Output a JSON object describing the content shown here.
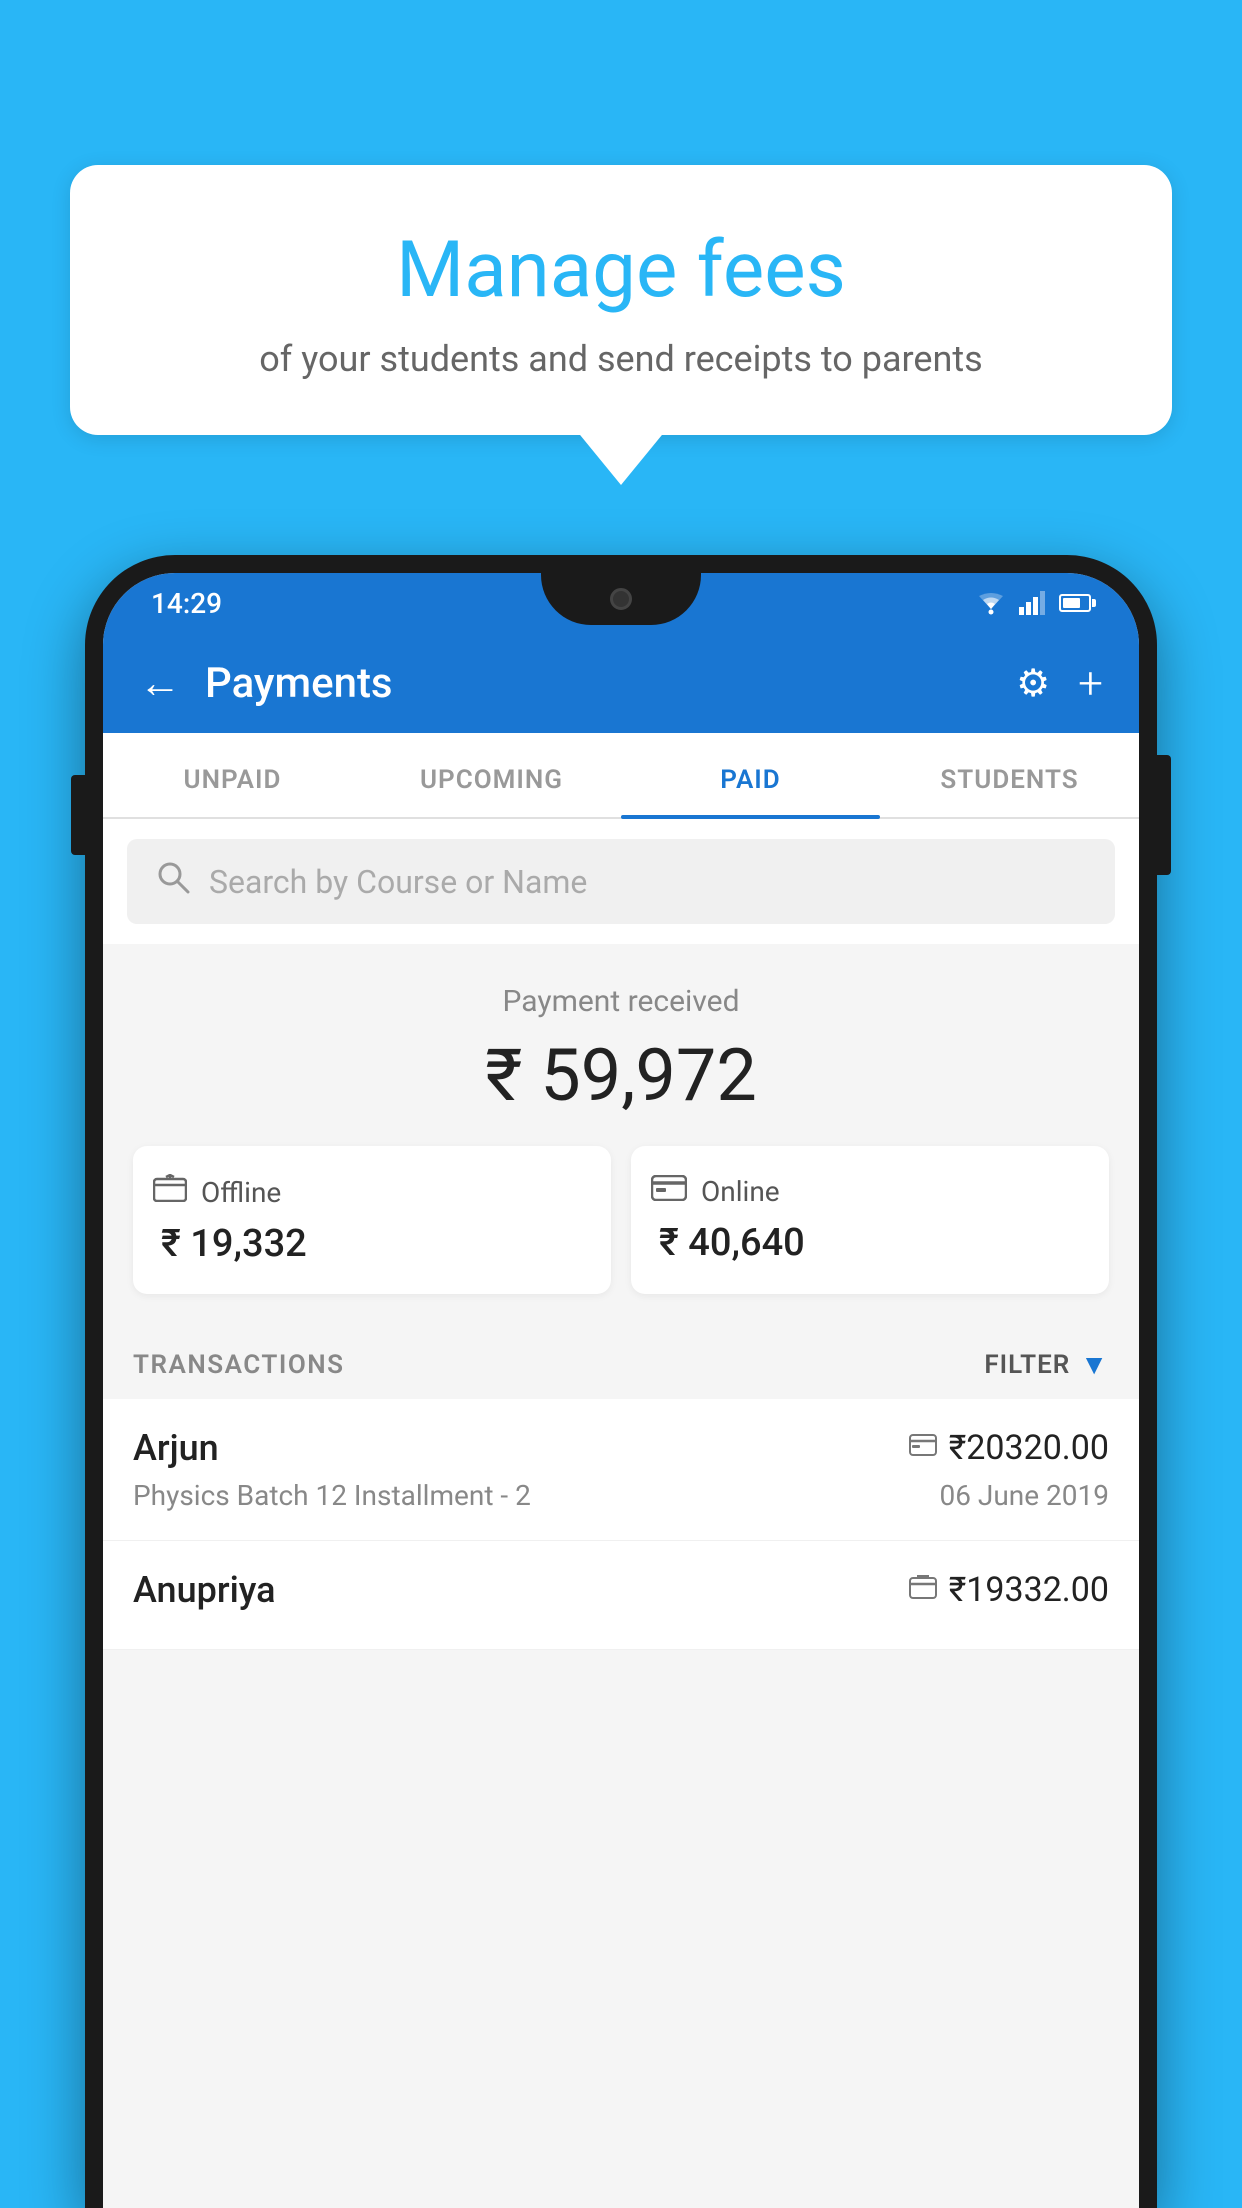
{
  "background_color": "#29b6f6",
  "bubble": {
    "title": "Manage fees",
    "subtitle": "of your students and send receipts to parents"
  },
  "status_bar": {
    "time": "14:29",
    "wifi": "▾",
    "signal": "▲",
    "battery": "▌"
  },
  "app_bar": {
    "title": "Payments",
    "back_icon": "←",
    "settings_icon": "⚙",
    "add_icon": "+"
  },
  "tabs": [
    {
      "label": "UNPAID",
      "active": false
    },
    {
      "label": "UPCOMING",
      "active": false
    },
    {
      "label": "PAID",
      "active": true
    },
    {
      "label": "STUDENTS",
      "active": false
    }
  ],
  "search": {
    "placeholder": "Search by Course or Name"
  },
  "payment_summary": {
    "label": "Payment received",
    "total": "₹ 59,972",
    "offline": {
      "type": "Offline",
      "amount": "₹ 19,332"
    },
    "online": {
      "type": "Online",
      "amount": "₹ 40,640"
    }
  },
  "transactions": {
    "section_label": "TRANSACTIONS",
    "filter_label": "FILTER",
    "items": [
      {
        "name": "Arjun",
        "amount": "₹20320.00",
        "course": "Physics Batch 12 Installment - 2",
        "date": "06 June 2019",
        "payment_type": "online"
      },
      {
        "name": "Anupriya",
        "amount": "₹19332.00",
        "course": "",
        "date": "",
        "payment_type": "offline"
      }
    ]
  }
}
